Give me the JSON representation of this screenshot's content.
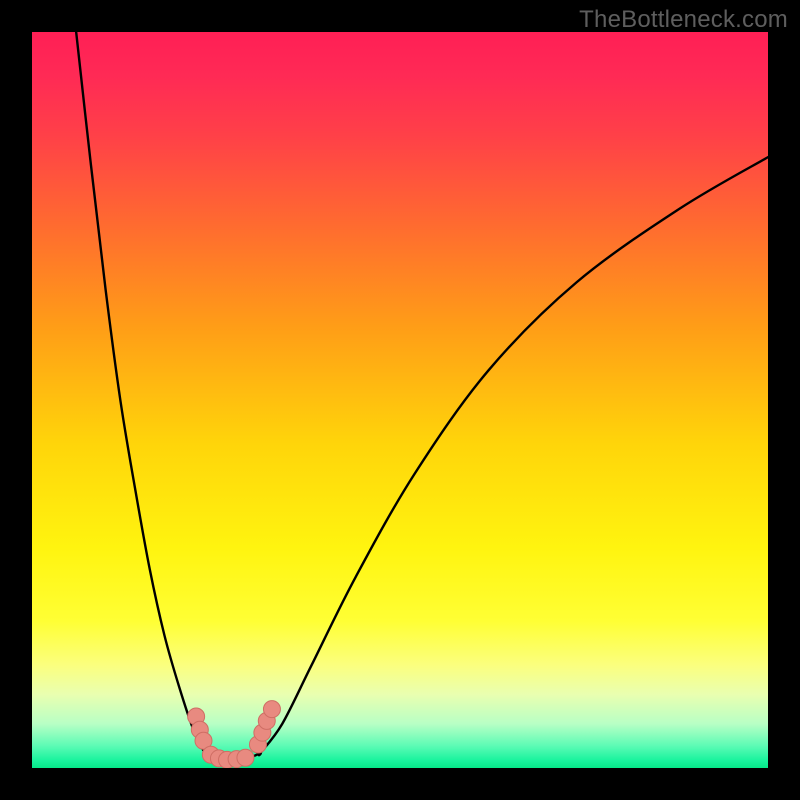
{
  "watermark": "TheBottleneck.com",
  "colors": {
    "curve_stroke": "#000000",
    "marker_fill": "#e88a80",
    "marker_stroke": "#cf6e64",
    "frame_bg": "#000000"
  },
  "chart_data": {
    "type": "line",
    "title": "",
    "xlabel": "",
    "ylabel": "",
    "xlim": [
      0,
      100
    ],
    "ylim": [
      0,
      100
    ],
    "note": "No axis labels, ticks, or numeric data labels are visible in the image. Curve values are estimated from pixel positions on a 0–100 normalized scale (x left→right, y bottom→top).",
    "series": [
      {
        "name": "left-branch",
        "x": [
          6,
          8,
          10,
          12,
          14,
          16,
          18,
          20,
          22,
          23.5
        ],
        "y": [
          100,
          82,
          65,
          50,
          38,
          27,
          18,
          11,
          5,
          2
        ]
      },
      {
        "name": "valley",
        "x": [
          23.5,
          25,
          27,
          29,
          31
        ],
        "y": [
          2,
          1.2,
          1,
          1.2,
          2
        ]
      },
      {
        "name": "right-branch",
        "x": [
          31,
          34,
          38,
          44,
          52,
          62,
          74,
          88,
          100
        ],
        "y": [
          2,
          6,
          14,
          26,
          40,
          54,
          66,
          76,
          83
        ]
      }
    ],
    "markers": [
      {
        "x": 22.3,
        "y": 7.0
      },
      {
        "x": 22.8,
        "y": 5.2
      },
      {
        "x": 23.3,
        "y": 3.7
      },
      {
        "x": 24.3,
        "y": 1.8
      },
      {
        "x": 25.4,
        "y": 1.3
      },
      {
        "x": 26.5,
        "y": 1.1
      },
      {
        "x": 27.8,
        "y": 1.2
      },
      {
        "x": 29.0,
        "y": 1.4
      },
      {
        "x": 30.7,
        "y": 3.2
      },
      {
        "x": 31.3,
        "y": 4.8
      },
      {
        "x": 31.9,
        "y": 6.4
      },
      {
        "x": 32.6,
        "y": 8.0
      }
    ]
  }
}
